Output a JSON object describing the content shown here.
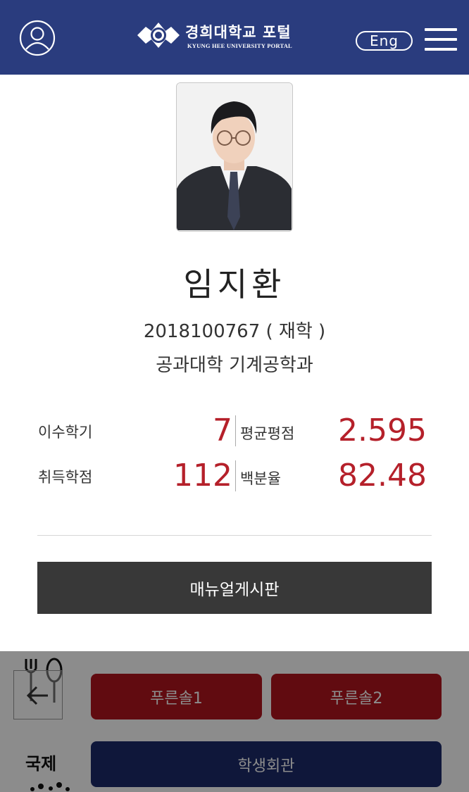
{
  "header": {
    "profile_icon": "user-circle-icon",
    "logo_title": "경희대학교 포털",
    "logo_subtitle": "KYUNG HEE UNIVERSITY PORTAL",
    "lang_label": "Eng",
    "menu_icon": "hamburger-menu-icon",
    "color": "#2a3c7e"
  },
  "profile": {
    "name": "임지환",
    "student_id": "2018100767 ( 재학 )",
    "department": "공과대학 기계공학과"
  },
  "stats": [
    {
      "label": "이수학기",
      "value": "7"
    },
    {
      "label": "평균평점",
      "value": "2.595"
    },
    {
      "label": "취득학점",
      "value": "112"
    },
    {
      "label": "백분율",
      "value": "82.48"
    }
  ],
  "manual_button": "매뉴얼게시판",
  "background": {
    "buttons": [
      "푸른솔1",
      "푸른솔2",
      "학생회관"
    ],
    "categories": [
      "국제"
    ],
    "icons": [
      "fork-spoon-icon",
      "back-arrow-icon"
    ]
  },
  "colors": {
    "accent": "#b5202a",
    "dark_button": "#383838",
    "bg_red": "#b1151e",
    "bg_navy": "#1d2a6b"
  }
}
